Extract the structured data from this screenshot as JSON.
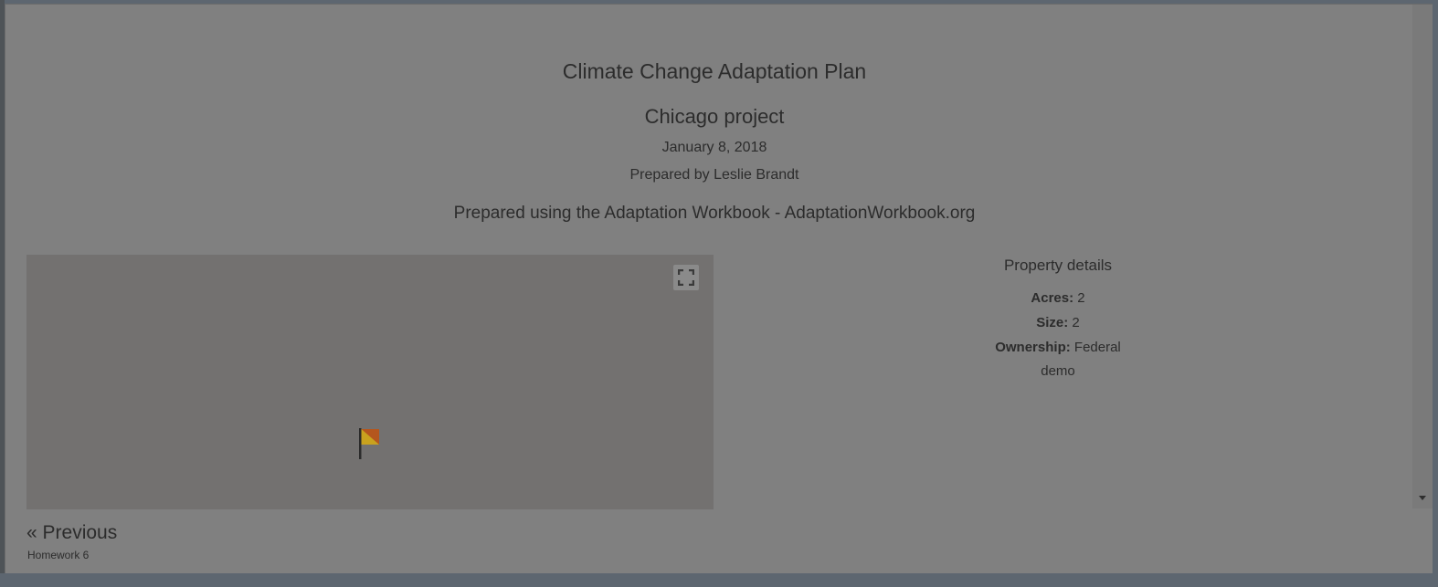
{
  "report": {
    "title": "Climate Change Adaptation Plan",
    "project": "Chicago project",
    "date": "January 8, 2018",
    "prepared_by": "Prepared by Leslie Brandt",
    "prepared_using": "Prepared using the Adaptation Workbook - AdaptationWorkbook.org"
  },
  "map": {
    "fullscreen_icon": "fullscreen-icon",
    "marker_icon": "flag-marker-icon"
  },
  "property": {
    "heading": "Property details",
    "acres_label": "Acres:",
    "acres_value": "2",
    "size_label": "Size:",
    "size_value": "2",
    "ownership_label": "Ownership:",
    "ownership_value": "Federal",
    "note": "demo"
  },
  "navigation": {
    "previous_label": "« Previous",
    "previous_subtitle": "Homework 6"
  }
}
